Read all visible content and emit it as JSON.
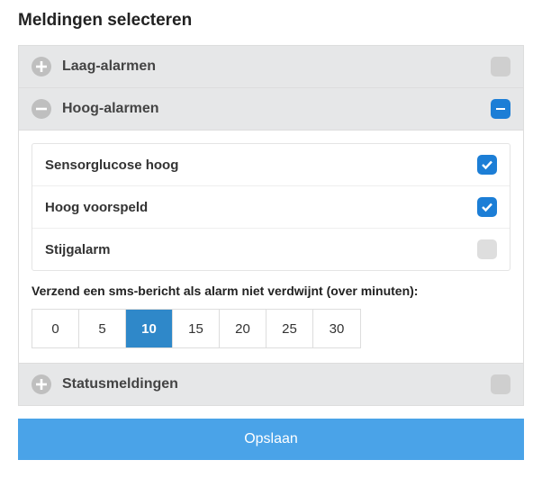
{
  "title": "Meldingen selecteren",
  "sections": {
    "low": {
      "label": "Laag-alarmen"
    },
    "high": {
      "label": "Hoog-alarmen",
      "options": [
        {
          "label": "Sensorglucose hoog",
          "checked": true
        },
        {
          "label": "Hoog voorspeld",
          "checked": true
        },
        {
          "label": "Stijgalarm",
          "checked": false
        }
      ],
      "sms_label": "Verzend een sms-bericht als alarm niet verdwijnt (over minuten):",
      "minutes": [
        "0",
        "5",
        "10",
        "15",
        "20",
        "25",
        "30"
      ],
      "selected_minute": "10"
    },
    "status": {
      "label": "Statusmeldingen"
    }
  },
  "save_label": "Opslaan"
}
